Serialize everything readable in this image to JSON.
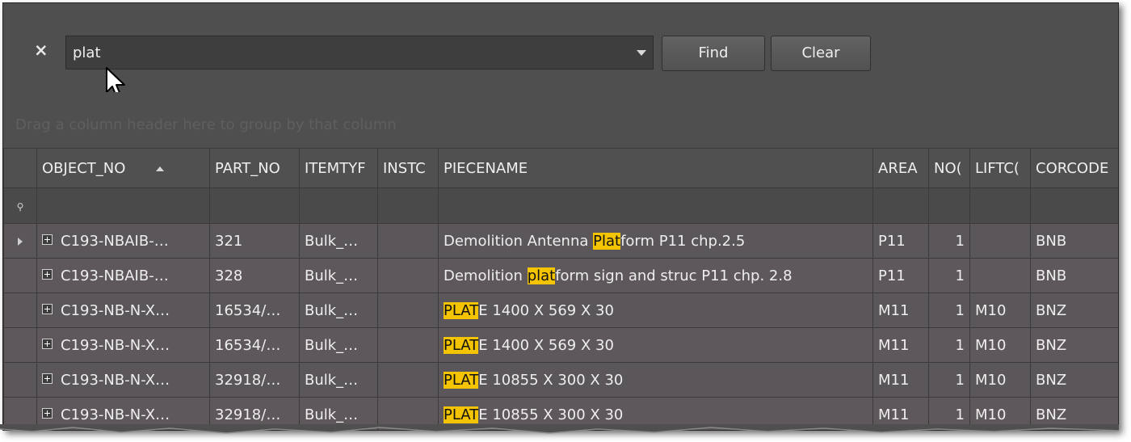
{
  "search": {
    "value": "plat",
    "find_label": "Find",
    "clear_label": "Clear",
    "close_symbol": "×"
  },
  "group_panel": {
    "text": "Drag a column header here to group by that column"
  },
  "columns": [
    "OBJECT_NO",
    "PART_NO",
    "ITEMTYF",
    "INSTC",
    "PIECENAME",
    "AREA",
    "NO(",
    "LIFTC(",
    "CORCODE"
  ],
  "sort": {
    "column": "OBJECT_NO",
    "direction": "ascending"
  },
  "rows": [
    {
      "object_no": "C193-NBAIB-…",
      "part_no": "321",
      "itemtype": "Bulk_…",
      "instc": "",
      "piece_pre": "Demolition Antenna ",
      "piece_hl": "Plat",
      "piece_post": "form P11 chp.2.5",
      "area": "P11",
      "no": "1",
      "liftc": "",
      "corcode": "BNB"
    },
    {
      "object_no": "C193-NBAIB-…",
      "part_no": "328",
      "itemtype": "Bulk_…",
      "instc": "",
      "piece_pre": "Demolition ",
      "piece_hl": "plat",
      "piece_post": "form sign and struc P11 chp. 2.8",
      "area": "P11",
      "no": "1",
      "liftc": "",
      "corcode": "BNB"
    },
    {
      "object_no": "C193-NB-N-X…",
      "part_no": "16534/…",
      "itemtype": "Bulk_…",
      "instc": "",
      "piece_pre": "",
      "piece_hl": "PLAT",
      "piece_post": "E 1400 X 569 X 30",
      "area": "M11",
      "no": "1",
      "liftc": "M10",
      "corcode": "BNZ"
    },
    {
      "object_no": "C193-NB-N-X…",
      "part_no": "16534/…",
      "itemtype": "Bulk_…",
      "instc": "",
      "piece_pre": "",
      "piece_hl": "PLAT",
      "piece_post": "E 1400 X 569 X 30",
      "area": "M11",
      "no": "1",
      "liftc": "M10",
      "corcode": "BNZ"
    },
    {
      "object_no": "C193-NB-N-X…",
      "part_no": "32918/…",
      "itemtype": "Bulk_…",
      "instc": "",
      "piece_pre": "",
      "piece_hl": "PLAT",
      "piece_post": "E 10855 X 300 X 30",
      "area": "M11",
      "no": "1",
      "liftc": "M10",
      "corcode": "BNZ"
    },
    {
      "object_no": "C193-NB-N-X…",
      "part_no": "32918/…",
      "itemtype": "Bulk_…",
      "instc": "",
      "piece_pre": "",
      "piece_hl": "PLAT",
      "piece_post": "E 10855 X 300 X 30",
      "area": "M11",
      "no": "1",
      "liftc": "M10",
      "corcode": "BNZ"
    }
  ],
  "colors": {
    "background": "#4f4f50",
    "row": "#5a5659",
    "highlight": "#f5c400",
    "text": "#eeeeee"
  },
  "icons": {
    "close": "close-icon",
    "dropdown": "chevron-down-icon",
    "sort": "sort-ascending-icon",
    "filter_row": "pin-icon",
    "expand": "expand-plus-icon",
    "row_indicator": "row-pointer-icon",
    "cursor": "mouse-pointer-icon"
  }
}
